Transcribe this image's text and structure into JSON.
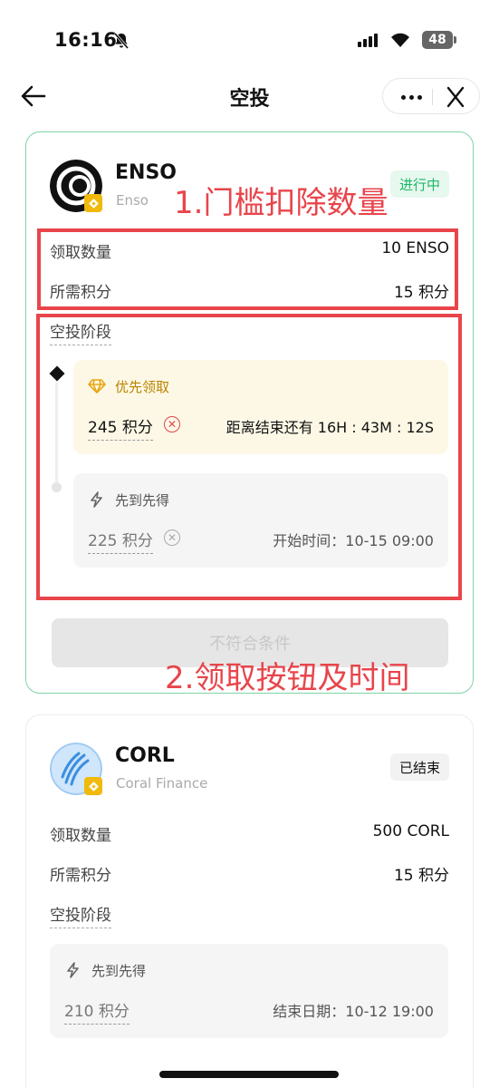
{
  "status_bar": {
    "time": "16:16",
    "battery": "48"
  },
  "header": {
    "title": "空投"
  },
  "annotations": {
    "note_1": "1.门槛扣除数量",
    "note_2": "2.领取按钮及时间"
  },
  "airdrops": [
    {
      "symbol": "ENSO",
      "name": "Enso",
      "status": "进行中",
      "claim_label": "领取数量",
      "claim_value": "10 ENSO",
      "points_label": "所需积分",
      "points_value": "15 积分",
      "stages_label": "空投阶段",
      "stages": [
        {
          "title": "优先领取",
          "points": "245 积分",
          "info": "距离结束还有 16H : 43M : 12S"
        },
        {
          "title": "先到先得",
          "points": "225 积分",
          "info": "开始时间：10-15 09:00"
        }
      ],
      "button_label": "不符合条件"
    },
    {
      "symbol": "CORL",
      "name": "Coral Finance",
      "status": "已结束",
      "claim_label": "领取数量",
      "claim_value": "500 CORL",
      "points_label": "所需积分",
      "points_value": "15 积分",
      "stages_label": "空投阶段",
      "stages": [
        {
          "title": "先到先得",
          "points": "210 积分",
          "info": "结束日期：10-12 19:00"
        }
      ]
    }
  ]
}
